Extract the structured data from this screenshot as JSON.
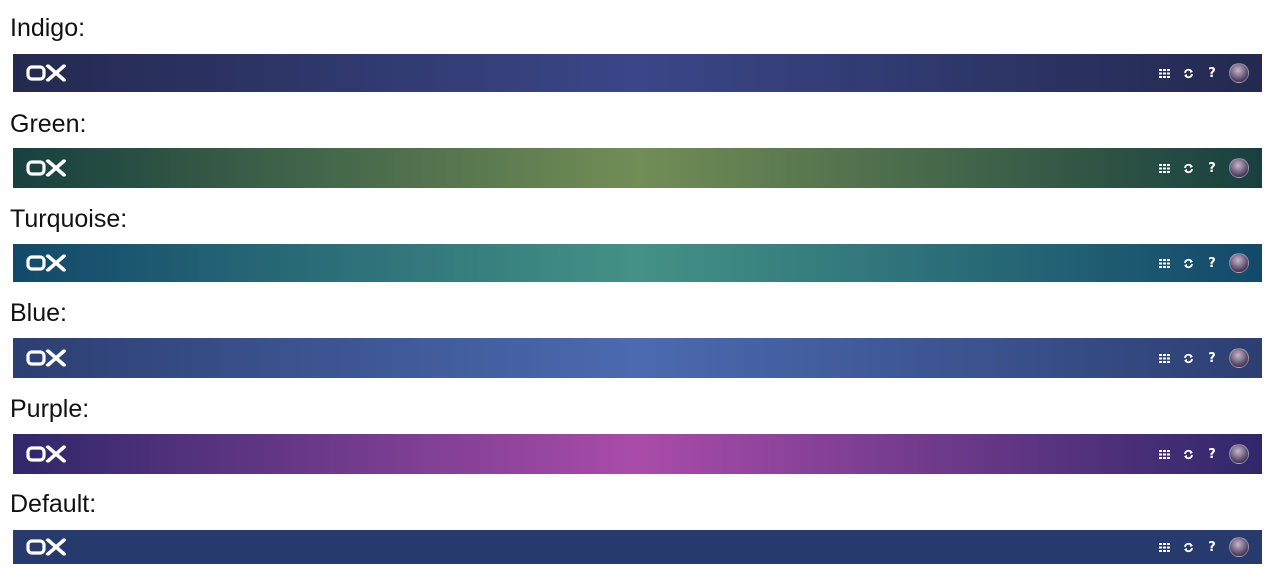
{
  "themes": [
    {
      "label": "Indigo:",
      "logo_text": "OX",
      "icons": [
        "apps-grid-icon",
        "refresh-icon",
        "help-icon",
        "user-avatar"
      ]
    },
    {
      "label": "Green:",
      "logo_text": "OX",
      "icons": [
        "apps-grid-icon",
        "refresh-icon",
        "help-icon",
        "user-avatar"
      ]
    },
    {
      "label": "Turquoise:",
      "logo_text": "OX",
      "icons": [
        "apps-grid-icon",
        "refresh-icon",
        "help-icon",
        "user-avatar"
      ]
    },
    {
      "label": "Blue:",
      "logo_text": "OX",
      "icons": [
        "apps-grid-icon",
        "refresh-icon",
        "help-icon",
        "user-avatar"
      ]
    },
    {
      "label": "Purple:",
      "logo_text": "OX",
      "icons": [
        "apps-grid-icon",
        "refresh-icon",
        "help-icon",
        "user-avatar"
      ]
    },
    {
      "label": "Default:",
      "logo_text": "OX",
      "icons": [
        "apps-grid-icon",
        "refresh-icon",
        "help-icon",
        "user-avatar"
      ]
    }
  ],
  "help_glyph": "?",
  "colors": {
    "indigo": {
      "edge": "#24294f",
      "center": "#3a4688"
    },
    "green": {
      "edge": "#17403f",
      "center": "#728d56"
    },
    "turquoise": {
      "edge": "#12496a",
      "center": "#449286"
    },
    "blue": {
      "edge": "#2c3f72",
      "center": "#4c6ab0"
    },
    "purple": {
      "edge": "#30276a",
      "center": "#a94ca9"
    },
    "default": {
      "solid": "#263a6e"
    },
    "label_text": "#111111",
    "icon": "#ffffff"
  }
}
